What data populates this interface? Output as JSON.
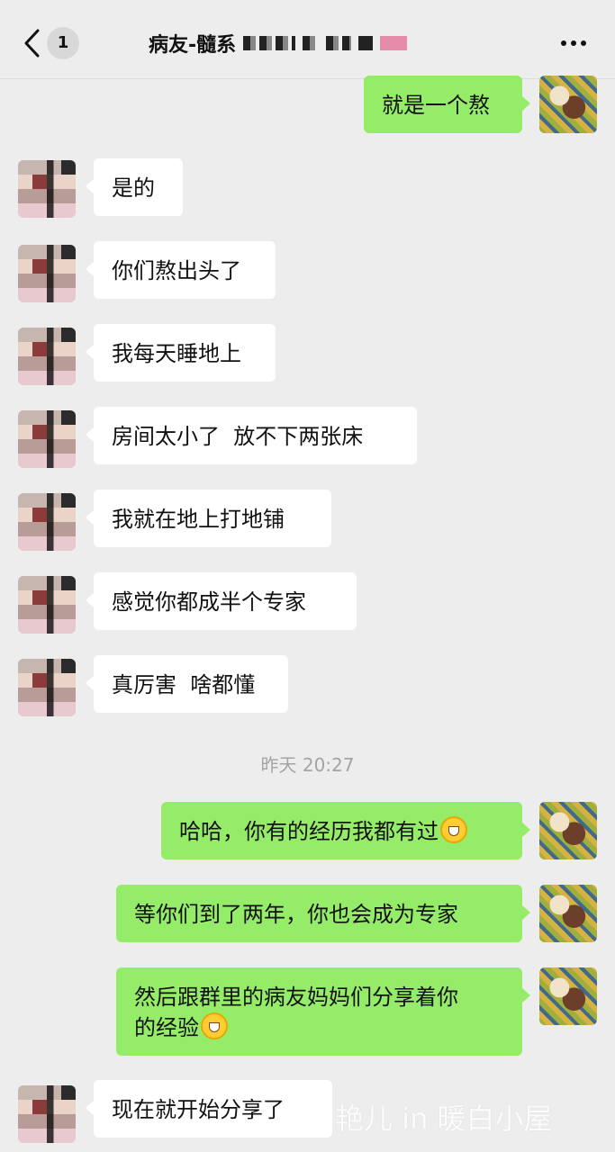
{
  "header": {
    "unread_count": "1",
    "title": "病友-髓系"
  },
  "messages": [
    {
      "side": "out",
      "text": "就是一个熬"
    },
    {
      "side": "in",
      "text": "是的"
    },
    {
      "side": "in",
      "text": "你们熬出头了"
    },
    {
      "side": "in",
      "text": "我每天睡地上"
    },
    {
      "side": "in",
      "text": "房间太小了  放不下两张床"
    },
    {
      "side": "in",
      "text": "我就在地上打地铺"
    },
    {
      "side": "in",
      "text": "感觉你都成半个专家"
    },
    {
      "side": "in",
      "text": "真厉害  啥都懂"
    },
    {
      "type": "timestamp",
      "text": "昨天 20:27"
    },
    {
      "side": "out",
      "text": "哈哈，你有的经历我都有过",
      "emoji": "grinning-emoji"
    },
    {
      "side": "out",
      "text": "等你们到了两年，你也会成为专家"
    },
    {
      "side": "out",
      "text_line1": "然后跟群里的病友妈妈们分享着你",
      "text_line2": "的经验",
      "emoji": "grinning-emoji"
    },
    {
      "side": "in",
      "text": "现在就开始分享了"
    }
  ],
  "watermark": "艳儿 in 暖白小屋",
  "colors": {
    "background": "#ededed",
    "outgoing_bubble": "#95ec69",
    "incoming_bubble": "#ffffff",
    "timestamp_text": "#a4a4a4"
  },
  "icons": {
    "back": "chevron-left-icon",
    "more": "more-dots-icon"
  }
}
